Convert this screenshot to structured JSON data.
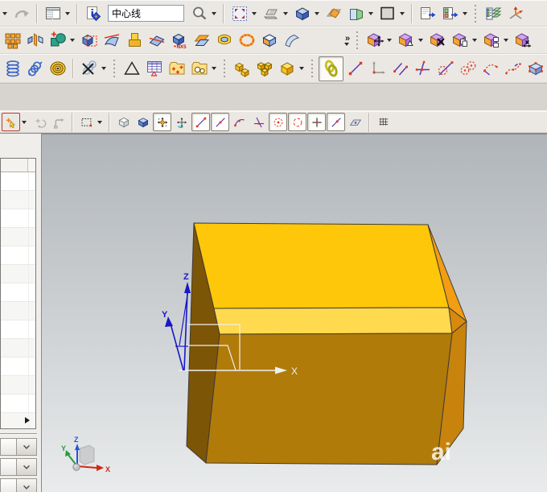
{
  "labels": {
    "nx5": "NX5",
    "overflow": "»",
    "watermark": "ai"
  },
  "search": {
    "value": "中心线"
  },
  "viewport": {
    "wcs": {
      "x": "X",
      "y": "Y",
      "z": "Z"
    },
    "triad": {
      "x": "X",
      "y": "Y",
      "z": "Z"
    }
  },
  "colors": {
    "toolbar_bg": "#ebe8e3",
    "gap_bg": "#d7d4cf",
    "viewport_top": "#b0b5b9",
    "viewport_bottom": "#e9ebec",
    "box_top": "#ffc709",
    "box_bevel": "#ffd94e",
    "box_front": "#b17b0a",
    "box_right": "#c8830d",
    "box_chamfer": "#f29d13",
    "box_tri": "#d8890e",
    "box_left": "#7d5506",
    "edge": "#3f3b33",
    "wcs_blue": "#1818c8",
    "wcs_white": "#eef0f0",
    "triad_x": "#d02818",
    "triad_y": "#2a9a3a",
    "triad_z": "#2a52d8"
  },
  "sidebar": {
    "table_rows": 14,
    "combos": [
      {
        "name": "view-combo-1"
      },
      {
        "name": "view-combo-2"
      },
      {
        "name": "view-combo-3"
      }
    ]
  },
  "toolbars": {
    "rows": [
      {
        "name": "standard-toolbar",
        "items": [
          {
            "type": "caret",
            "name": "toolbar-extra-caret"
          },
          {
            "icon": "redo",
            "name": "redo-button",
            "disabled": true
          },
          {
            "type": "sep"
          },
          {
            "icon": "window-table",
            "name": "view-layout-button",
            "caret": true
          },
          {
            "type": "sep"
          },
          {
            "icon": "info",
            "name": "information-button"
          },
          {
            "type": "input",
            "name": "command-finder-input",
            "value_key": "search.value"
          },
          {
            "icon": "search",
            "name": "search-button",
            "caret": true
          },
          {
            "type": "sep"
          },
          {
            "icon": "fit-view",
            "name": "fit-view-button",
            "caret": true
          },
          {
            "icon": "laptop",
            "name": "display-mode-button",
            "caret": true
          },
          {
            "icon": "cube-blue",
            "name": "rendering-style-button",
            "caret": true
          },
          {
            "icon": "clip-plane",
            "name": "clip-section-button"
          },
          {
            "icon": "section-view",
            "name": "view-section-button",
            "caret": true
          },
          {
            "icon": "square-gray",
            "name": "background-button",
            "caret": true
          },
          {
            "type": "sep"
          },
          {
            "icon": "win-export",
            "name": "window-export-button"
          },
          {
            "icon": "win-import",
            "name": "window-import-button",
            "caret": true
          },
          {
            "type": "handle"
          },
          {
            "icon": "layers",
            "name": "layer-settings-button"
          },
          {
            "icon": "csys",
            "name": "wcs-orient-button"
          }
        ]
      },
      {
        "name": "feature-toolbar",
        "items": [
          {
            "icon": "pattern-cubes",
            "name": "pattern-feature-button"
          },
          {
            "icon": "mirror-feat",
            "name": "mirror-feature-button"
          },
          {
            "icon": "boolean",
            "name": "unite-button",
            "caret": true
          },
          {
            "icon": "trim-cube",
            "name": "trim-body-button"
          },
          {
            "icon": "trimmed-sheet",
            "name": "trimmed-sheet-button"
          },
          {
            "icon": "extrude-block",
            "name": "extrude-button"
          },
          {
            "icon": "split-body",
            "name": "split-body-button"
          },
          {
            "icon": "nx5",
            "name": "nx5-feature-button"
          },
          {
            "icon": "offset-face",
            "name": "offset-surface-button"
          },
          {
            "icon": "shell2",
            "name": "shell-button"
          },
          {
            "icon": "ring-dashed",
            "name": "thread-button"
          },
          {
            "icon": "cube2",
            "name": "feature-cube-button"
          },
          {
            "icon": "flange",
            "name": "flange-button"
          },
          {
            "type": "overflow",
            "name": "toolbar-overflow"
          },
          {
            "type": "handle"
          },
          {
            "icon": "syn-move",
            "name": "move-face-button",
            "caret": true
          },
          {
            "icon": "syn-delta",
            "name": "offset-region-button",
            "caret": true
          },
          {
            "icon": "syn-delete",
            "name": "delete-face-button"
          },
          {
            "icon": "syn-copy",
            "name": "copy-face-button",
            "caret": true
          },
          {
            "icon": "syn-two",
            "name": "resize-blend-button",
            "caret": true
          },
          {
            "icon": "syn-resize",
            "name": "resize-face-button"
          }
        ]
      },
      {
        "name": "detail-feature-toolbar",
        "items": [
          {
            "icon": "coil",
            "name": "thread-coil-button"
          },
          {
            "icon": "spring",
            "name": "spring-button"
          },
          {
            "icon": "washers",
            "name": "washer-button"
          },
          {
            "type": "sep"
          },
          {
            "icon": "no-spring",
            "name": "suppress-spring-button",
            "caret": true
          },
          {
            "type": "handle"
          },
          {
            "icon": "triangle",
            "name": "draft-button"
          },
          {
            "icon": "table-tri",
            "name": "tolerance-table-button"
          },
          {
            "icon": "folder-plus",
            "name": "group-add-button"
          },
          {
            "icon": "folder-circles",
            "name": "group-circles-button",
            "caret": true
          },
          {
            "type": "handle"
          },
          {
            "icon": "ycubes1",
            "name": "assembly-cubes-button"
          },
          {
            "icon": "ycubes2",
            "name": "assembly-pattern-button"
          },
          {
            "icon": "ycube3",
            "name": "assembly-cube-button",
            "caret": true
          },
          {
            "type": "handle"
          },
          {
            "icon": "chain",
            "name": "constraints-toggle-button",
            "pressed": true,
            "framed": true
          },
          {
            "icon": "sk-line",
            "name": "sketch-line-button"
          },
          {
            "icon": "sk-axes",
            "name": "sketch-dimension-button"
          },
          {
            "icon": "sk-parallel",
            "name": "parallel-constraint-button"
          },
          {
            "icon": "sk-perp",
            "name": "perpendicular-constraint-button"
          },
          {
            "icon": "sk-tangent",
            "name": "tangent-constraint-button"
          },
          {
            "icon": "sk-2circles",
            "name": "concentric-constraint-button"
          },
          {
            "icon": "sk-arc",
            "name": "arc-constraint-button"
          },
          {
            "icon": "sk-spline",
            "name": "spline-constraint-button"
          },
          {
            "icon": "cube-points",
            "name": "point-set-button"
          }
        ]
      },
      {
        "name": "snap-point-toolbar",
        "items": [
          {
            "icon": "sel-filter",
            "name": "selection-filter-button",
            "redbox": true,
            "caret": true
          },
          {
            "icon": "rotate-gray",
            "name": "rotate-tool-button",
            "disabled": true
          },
          {
            "icon": "move-gray",
            "name": "pan-tool-button",
            "disabled": true
          },
          {
            "type": "sep"
          },
          {
            "icon": "sel-rect",
            "name": "rectangle-select-button",
            "caret": true
          },
          {
            "type": "sep"
          },
          {
            "icon": "iso-box",
            "name": "work-plane-button"
          },
          {
            "icon": "cube-blue",
            "name": "shaded-view-button"
          },
          {
            "icon": "snap-green",
            "name": "snap-point-toggle-button",
            "pressed": true
          },
          {
            "icon": "snap-rotate",
            "name": "rotate-point-button"
          },
          {
            "icon": "pt-end",
            "name": "end-point-button",
            "pressed": true
          },
          {
            "icon": "pt-mid",
            "name": "mid-point-button",
            "pressed": true
          },
          {
            "icon": "pt-ctrl",
            "name": "control-point-button"
          },
          {
            "icon": "pt-int",
            "name": "intersection-point-button"
          },
          {
            "icon": "pt-center",
            "name": "arc-center-button",
            "pressed": true
          },
          {
            "icon": "pt-quad",
            "name": "quadrant-point-button",
            "pressed": true
          },
          {
            "icon": "pt-exist",
            "name": "existing-point-button",
            "pressed": true
          },
          {
            "icon": "pt-oncurve",
            "name": "point-on-curve-button",
            "pressed": true
          },
          {
            "icon": "pt-onface",
            "name": "point-on-face-button"
          },
          {
            "type": "sep"
          },
          {
            "icon": "grid-icon",
            "name": "grid-button"
          }
        ]
      }
    ]
  }
}
